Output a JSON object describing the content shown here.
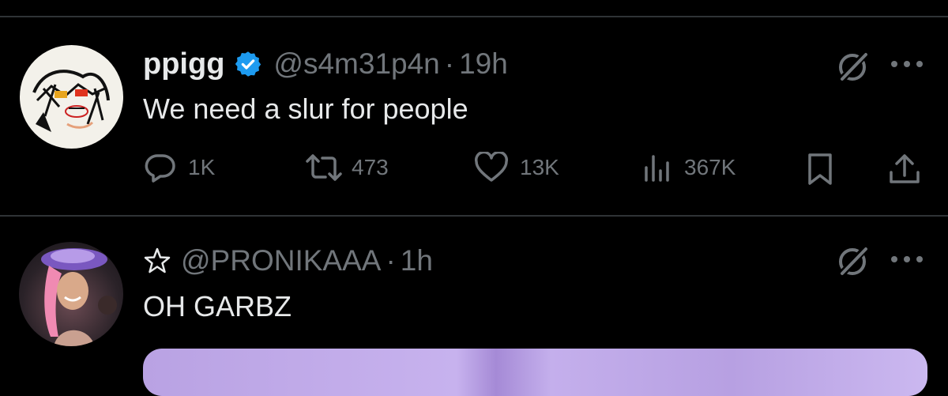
{
  "tweets": [
    {
      "name": "ppigg",
      "verified": true,
      "handle": "@s4m31p4n",
      "separator": "·",
      "time": "19h",
      "text": "We need a slur for people",
      "actions": {
        "replies": "1K",
        "retweets": "473",
        "likes": "13K",
        "views": "367K"
      }
    },
    {
      "name_prefix_icon": "star-outline-icon",
      "handle": "@PRONIKAAA",
      "separator": "·",
      "time": "1h",
      "text": "OH GARBZ"
    }
  ],
  "colors": {
    "background": "#000000",
    "text": "#e7e9ea",
    "muted": "#71767b",
    "verified_blue": "#1d9bf0",
    "divider": "#2f3336"
  }
}
